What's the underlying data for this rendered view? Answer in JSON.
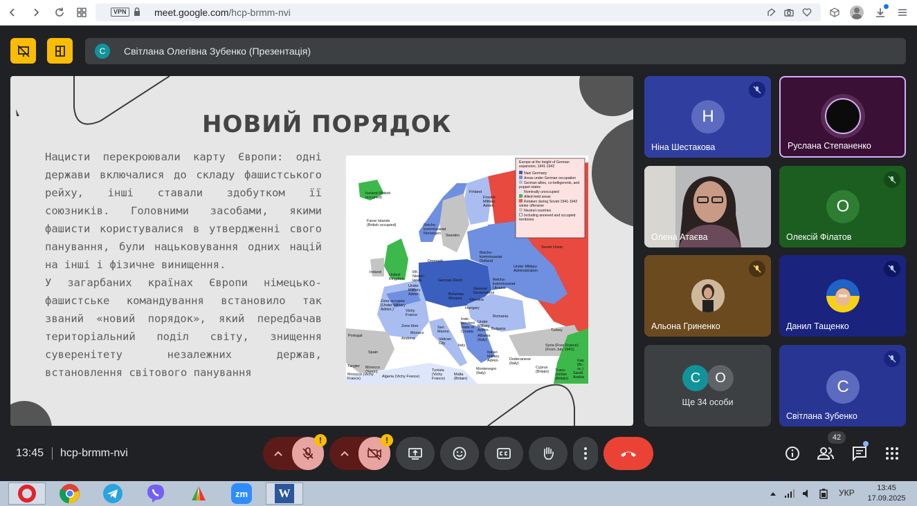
{
  "browser": {
    "vpn_label": "VPN",
    "url_host": "meet.google.com",
    "url_path": "/hcp-brmm-nvi"
  },
  "presenter": {
    "avatar_letter": "С",
    "label": "Світлана Олегівна Зубенко (Презентація)"
  },
  "slide": {
    "title": "НОВИЙ ПОРЯДОК",
    "paragraph1": "Нацисти перекроювали карту Європи: одні держави включалися до складу фашистського рейху, інші ставали здобутком її союзників. Головними засобами, якими фашисти користувалися в утвердженні свого панування, були нацьковування одних націй на інші і фізичне винищення.",
    "paragraph2": "У загарбаних країнах Європи німецько-фашистське командування встановило так званий «новий порядок», який передбачав територіальний поділ світу, знищення суверенітету незалежних держав, встановлення світового панування",
    "map": {
      "legend_title": "Europe at the height of German expansion, 1941-1942",
      "legend": [
        {
          "label": "Nazi Germany",
          "color": "#3a5fbf"
        },
        {
          "label": "Areas under German occupation",
          "color": "#6f8fe0"
        },
        {
          "label": "German allies, co-belligerents, and puppet states",
          "color": "#a9bdf1"
        },
        {
          "label": "Nominally unoccupied",
          "color": "#dde6fb"
        },
        {
          "label": "Allied-held areas",
          "color": "#3db84a"
        },
        {
          "label": "Retaken during Soviet 1941-1942 winter offensive",
          "color": "#e85d5d"
        },
        {
          "label": "Neutral countries",
          "color": "#c4c4c4"
        },
        {
          "label": "Including annexed and occupied territories",
          "color": "#ffffff"
        }
      ],
      "labels": {
        "iceland": "Iceland (British occupied)",
        "faroe": "Faroe Islands (British occupied)",
        "finland": "Finland",
        "finnish_admin": "Finnish Military Admin.",
        "norway": "Reichs-kommissariat Norwegen",
        "sweden": "Sweden",
        "denmark": "Denmark",
        "uk": "United Kingdom",
        "ireland": "Ireland",
        "netherlands": "RK Nieder-lande",
        "belgium": "Under Military Admin.",
        "german_reich": "German Reich",
        "ostland": "Reichs-kommissariat Ostland",
        "ukraine": "Reichs-kommissariat Ukraine",
        "military_admin": "Under Military Administration",
        "soviet": "Soviet Union",
        "gen_gov": "General Government",
        "bohemia": "Bohemia Moravia",
        "slovakia": "Slovakia",
        "hungary": "Hungary",
        "romania": "Romania",
        "zone_occ": "Zone occupée (Under Military Admin.)",
        "vichy": "Vichy France",
        "zone_libre": "Zone libre",
        "portugal": "Portugal",
        "spain": "Spain",
        "andorra": "Andorra",
        "monaco": "Monaco",
        "san_marino": "San Marino",
        "vatican": "Vatican City",
        "italy": "Italy",
        "croatia": "Inde-pendent State of Croatia",
        "serbia": "Under Military Admin.",
        "bulgaria": "Bulgaria",
        "albania": "Albania (Italy)",
        "montenegro": "Montenegro (Italy)",
        "greece": "Italian Military Admin.",
        "dodecanese": "Dodecanese (Italy)",
        "turkey": "Turkey",
        "syria": "Syria (Free France) (From July 1941)",
        "iraq": "Iraq (Br.-oc.)",
        "cyprus": "Cyprus (Britain)",
        "transjordan": "Trans-Jordan (Britain)",
        "saudi": "Saudi Arabia",
        "tangier": "Tangier",
        "morocco_sp": "Morocco (Spain)",
        "morocco_vf": "Morocco (Vichy France)",
        "algeria": "Algeria (Vichy France)",
        "tunisia": "Tunisia (Vichy France)",
        "malta": "Malta (Britain)"
      }
    }
  },
  "participants": [
    {
      "name": "Ніна Шестакова",
      "avatar": "Н",
      "avatar_color": "#5c6bc0",
      "bg": "#303f9f",
      "muted": true
    },
    {
      "name": "Руслана Степаненко",
      "avatar": "",
      "avatar_color": "#0d0d0d",
      "bg": "#3a1037",
      "muted": false
    },
    {
      "name": "Олена Атаєва",
      "avatar": "",
      "bg": "#9ea0a4",
      "muted": false
    },
    {
      "name": "Олексій Філатов",
      "avatar": "О",
      "avatar_color": "#2e7d32",
      "bg": "#1b5e20",
      "muted": true
    },
    {
      "name": "Альона Гриненко",
      "avatar": "",
      "bg": "#6b4a1f",
      "muted": true
    },
    {
      "name": "Данил Тащенко",
      "avatar": "",
      "bg": "#1a237e",
      "muted": true
    },
    {
      "name": "Ще 34 особи",
      "avatar": "С",
      "avatar2": "О",
      "bg": "#3c4043",
      "muted": false
    },
    {
      "name": "Світлана Зубенко",
      "avatar": "С",
      "avatar_color": "#5c6bc0",
      "bg": "#283593",
      "muted": true
    }
  ],
  "bottom": {
    "time": "13:45",
    "meeting_code": "hcp-brmm-nvi",
    "participant_count": "42"
  },
  "taskbar": {
    "lang": "УКР",
    "clock_time": "13:45",
    "clock_date": "17.09.2025"
  },
  "colors": {
    "meet_bg": "#202124",
    "accent_yellow": "#fbbc04",
    "end_call": "#ea4335",
    "muted_red": "#e8a4a0"
  }
}
